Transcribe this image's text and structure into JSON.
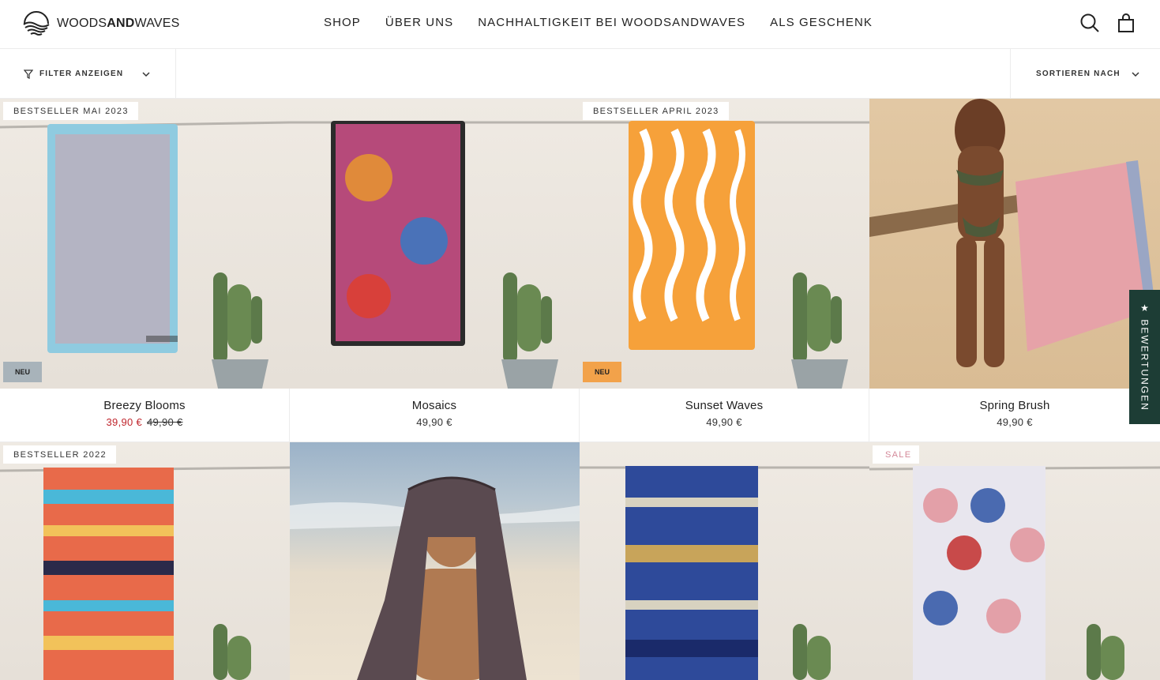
{
  "brand": {
    "light": "WOODS",
    "bold": "AND",
    "rest": "WAVES"
  },
  "nav": [
    "SHOP",
    "ÜBER UNS",
    "NACHHALTIGKEIT BEI WOODSANDWAVES",
    "ALS GESCHENK"
  ],
  "icons": {
    "search": "search-icon",
    "cart": "bag-icon",
    "filter": "filter-icon",
    "chevron": "chevron-down-icon"
  },
  "toolbar": {
    "filter_label": "FILTER ANZEIGEN",
    "sort_label": "SORTIEREN NACH"
  },
  "reviews_tab": "★ BEWERTUNGEN",
  "colors": {
    "sale_price": "#c0262d",
    "badge_new_grey": "#a8b3ba",
    "badge_new_orange": "#f2a24a",
    "reviews_bg": "#1d3d35"
  },
  "products": [
    {
      "name": "Breezy Blooms",
      "price": "39,90 €",
      "old_price": "49,90 €",
      "badge": "BESTSELLER MAI 2023",
      "flag": "NEU",
      "flag_color": "grey"
    },
    {
      "name": "Mosaics",
      "price": "49,90 €"
    },
    {
      "name": "Sunset Waves",
      "price": "49,90 €",
      "badge": "BESTSELLER APRIL 2023",
      "flag": "NEU",
      "flag_color": "orange"
    },
    {
      "name": "Spring Brush",
      "price": "49,90 €"
    },
    {
      "badge": "BESTSELLER 2022"
    },
    {},
    {},
    {
      "badge": "SALE"
    }
  ]
}
